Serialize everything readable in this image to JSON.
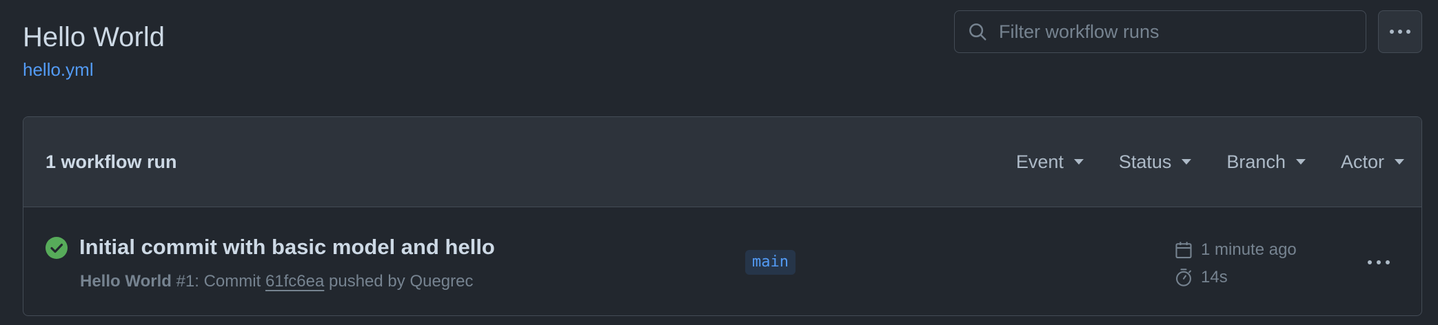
{
  "header": {
    "title": "Hello World",
    "workflow_file": "hello.yml"
  },
  "search": {
    "placeholder": "Filter workflow runs",
    "value": ""
  },
  "runs_box": {
    "count_label": "1 workflow run",
    "filters": [
      {
        "label": "Event"
      },
      {
        "label": "Status"
      },
      {
        "label": "Branch"
      },
      {
        "label": "Actor"
      }
    ],
    "runs": [
      {
        "status": "success",
        "title": "Initial commit with basic model and hello",
        "workflow_name": "Hello World",
        "run_number": "#1",
        "meta_commit_prefix": ": Commit",
        "commit_sha": "61fc6ea",
        "meta_suffix": "pushed by Quegrec",
        "branch": "main",
        "created": "1 minute ago",
        "duration": "14s"
      }
    ]
  },
  "colors": {
    "background": "#22272e",
    "accent_link": "#539bf5",
    "success": "#57ab5a",
    "border": "#444c56"
  },
  "icons": {
    "search": "search-icon",
    "kebab": "kebab-horizontal-icon",
    "status": "check-circle-fill-icon",
    "calendar": "calendar-icon",
    "stopwatch": "stopwatch-icon",
    "caret": "triangle-down-icon"
  }
}
